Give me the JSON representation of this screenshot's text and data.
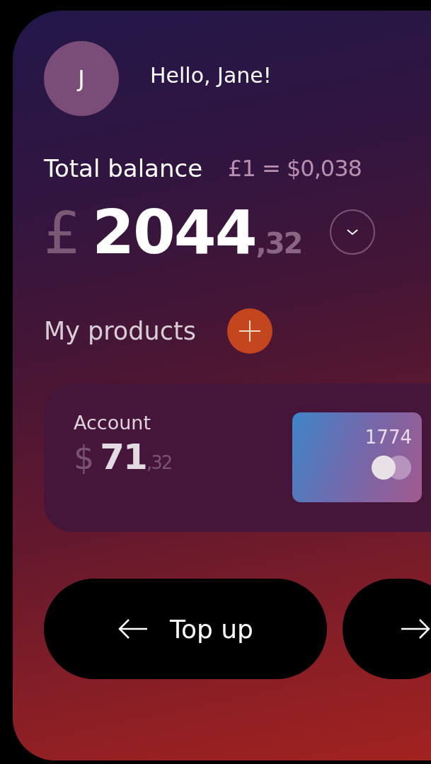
{
  "greeting": {
    "avatar_initial": "J",
    "text": "Hello, Jane!"
  },
  "balance": {
    "title": "Total balance",
    "rate": "£1 = $0,038",
    "currency": "£",
    "whole": "2044",
    "fraction": ",32"
  },
  "products": {
    "title": "My products",
    "items": [
      {
        "name": "Account",
        "currency": "$",
        "whole": "71",
        "fraction": ",32",
        "card_number": "1774"
      }
    ]
  },
  "actions": [
    {
      "kind": "labeled",
      "label": "Top up"
    },
    {
      "kind": "icon"
    }
  ]
}
